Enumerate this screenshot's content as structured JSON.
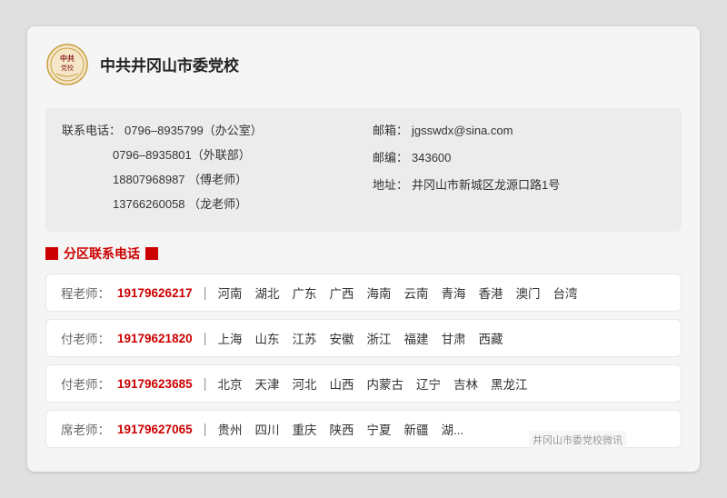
{
  "header": {
    "school_name": "中共井冈山市委党校"
  },
  "contact": {
    "phone_label": "联系电话：",
    "phone1": "0796–8935799（办公室）",
    "phone2": "0796–8935801（外联部）",
    "phone3": "18807968987 （傅老师）",
    "phone4": "13766260058 （龙老师）",
    "email_label": "邮箱：",
    "email": "jgsswdx@sina.com",
    "postcode_label": "邮编：",
    "postcode": "343600",
    "address_label": "地址：",
    "address": "井冈山市新城区龙源口路1号"
  },
  "section_title": "分区联系电话",
  "regions": [
    {
      "teacher": "程老师：",
      "phone": "19179626217",
      "areas": [
        "河南",
        "湖北",
        "广东",
        "广西",
        "海南",
        "云南",
        "青海",
        "香港",
        "澳门",
        "台湾"
      ]
    },
    {
      "teacher": "付老师：",
      "phone": "19179621820",
      "areas": [
        "上海",
        "山东",
        "江苏",
        "安徽",
        "浙江",
        "福建",
        "甘肃",
        "西藏"
      ]
    },
    {
      "teacher": "付老师：",
      "phone": "19179623685",
      "areas": [
        "北京",
        "天津",
        "河北",
        "山西",
        "内蒙古",
        "辽宁",
        "吉林",
        "黑龙江"
      ]
    },
    {
      "teacher": "席老师：",
      "phone": "19179627065",
      "areas": [
        "贵州",
        "四川",
        "重庆",
        "陕西",
        "宁夏",
        "新疆",
        "湖..."
      ]
    }
  ],
  "watermark": "井冈山市委党校微讯"
}
